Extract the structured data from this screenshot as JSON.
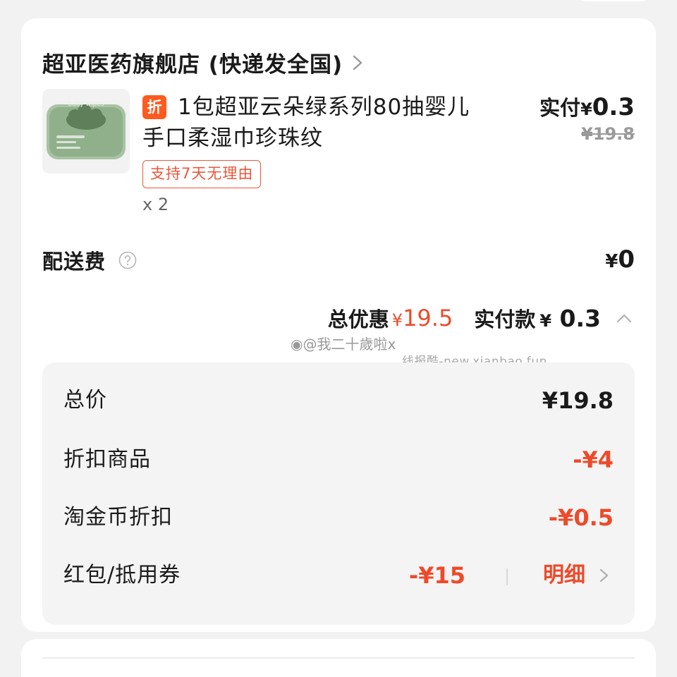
{
  "store": {
    "name": "超亚医药旗舰店 (快递发全国)"
  },
  "product": {
    "discount_tag": "折",
    "title": "1包超亚云朵绿系列80抽婴儿手口柔湿巾珍珠纹",
    "return_badge": "支持7天无理由",
    "quantity": "x 2",
    "paid_label": "实付",
    "currency": "¥",
    "paid_amount": "0.3",
    "original_price": "¥19.8",
    "package_text": "baby wipes"
  },
  "shipping": {
    "label": "配送费",
    "currency": "¥",
    "fee": "0"
  },
  "summary": {
    "discount_label": "总优惠",
    "discount_currency": "¥",
    "discount_amount": "19.5",
    "paid_label": "实付款",
    "paid_currency": "¥",
    "paid_amount": "0.3"
  },
  "watermark": {
    "line1": "@我二十歲啦x",
    "line2": "线报酷-new.xianbao.fun"
  },
  "breakdown": {
    "total_label": "总价",
    "total_value": "¥19.8",
    "discount_item_label": "折扣商品",
    "discount_item_value": "-¥4",
    "coin_label": "淘金币折扣",
    "coin_value": "-¥0.5",
    "coupon_label": "红包/抵用券",
    "coupon_value": "-¥15",
    "detail_label": "明细"
  },
  "colors": {
    "accent": "#ee4a2a",
    "tag": "#ff5a1f",
    "product_green": "#8fb08a"
  },
  "icons": [
    "chevron-right-icon",
    "help-circle-icon",
    "chevron-up-icon",
    "weibo-icon"
  ]
}
